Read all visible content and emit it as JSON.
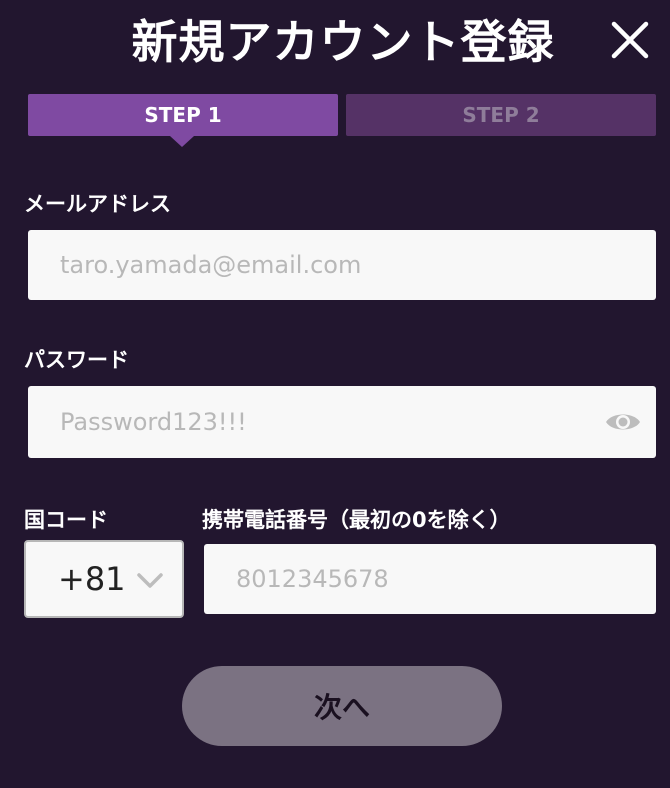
{
  "header": {
    "title": "新規アカウント登録",
    "close_icon": "close-icon"
  },
  "steps": [
    {
      "label": "STEP 1",
      "active": true
    },
    {
      "label": "STEP 2",
      "active": false
    }
  ],
  "form": {
    "email": {
      "label": "メールアドレス",
      "value": "",
      "placeholder": "taro.yamada@email.com"
    },
    "password": {
      "label": "パスワード",
      "value": "",
      "placeholder": "Password123!!!",
      "toggle_icon": "eye-icon"
    },
    "country_code": {
      "label": "国コード",
      "selected": "+81"
    },
    "phone": {
      "label": "携帯電話番号（最初の0を除く）",
      "value": "",
      "placeholder": "8012345678"
    }
  },
  "actions": {
    "next_label": "次へ"
  },
  "colors": {
    "background": "#22162f",
    "step_active": "#7f4aa2",
    "step_inactive": "#553266",
    "button_disabled": "#7b7282"
  }
}
